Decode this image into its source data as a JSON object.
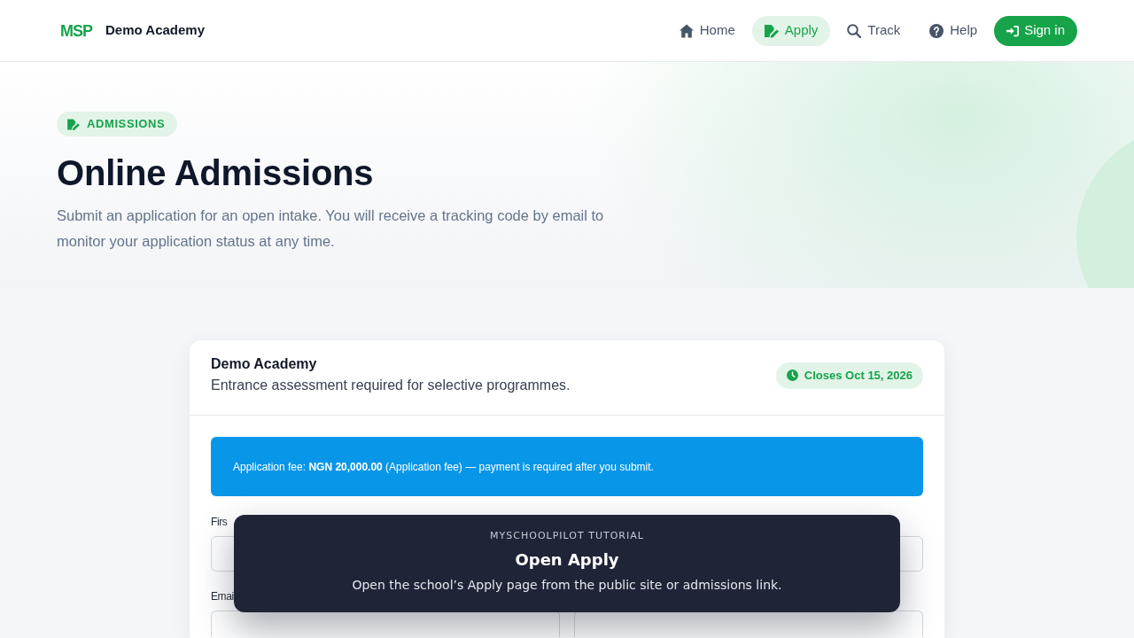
{
  "navbar": {
    "logo": "MSP",
    "brand": "Demo Academy",
    "links": [
      {
        "label": "Home",
        "selected": false
      },
      {
        "label": "Apply",
        "selected": true
      },
      {
        "label": "Track",
        "selected": false
      },
      {
        "label": "Help",
        "selected": false
      }
    ],
    "sign_in": "Sign in"
  },
  "hero": {
    "badge": "ADMISSIONS",
    "title": "Online Admissions",
    "lead": "Submit an application for an open intake. You will receive a tracking code by email to monitor your application status at any time."
  },
  "card": {
    "title": "Demo Academy",
    "subtitle": "Entrance assessment required for selective programmes.",
    "deadline": "Closes Oct 15, 2026",
    "notice": "Application fee: **NGN 20,000.00** (Application fee) — payment is required after you submit.",
    "form": {
      "rows": [
        {
          "label": "Firs"
        },
        {
          "label": "Emai"
        }
      ]
    }
  },
  "tutorial": {
    "eyebrow": "MYSCHOOLPILOT TUTORIAL",
    "title": "Open Apply",
    "text": "Open the school’s Apply page from the public site or admissions link."
  }
}
